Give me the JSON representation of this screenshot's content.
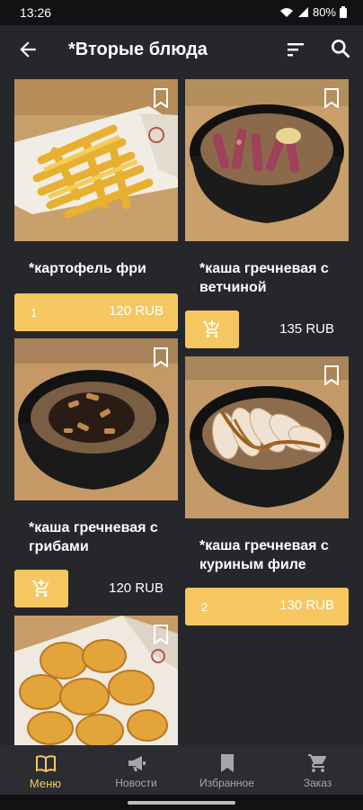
{
  "status": {
    "time": "13:26",
    "battery": "80%"
  },
  "header": {
    "title": "*Вторые блюда"
  },
  "products": [
    {
      "name": "*картофель фри",
      "price": "120 RUB",
      "qty": "1",
      "image": "fries"
    },
    {
      "name": "*каша гречневая с ветчиной",
      "price": "135 RUB",
      "image": "buckwheat-ham"
    },
    {
      "name": "*каша гречневая с грибами",
      "price": "120 RUB",
      "image": "buckwheat-mushrooms"
    },
    {
      "name": "*каша гречневая с куриным филе",
      "price": "130 RUB",
      "qty": "2",
      "image": "buckwheat-chicken"
    },
    {
      "name": "",
      "image": "nuggets"
    }
  ],
  "nav": [
    {
      "label": "Меню",
      "icon": "book-icon",
      "active": true
    },
    {
      "label": "Новости",
      "icon": "megaphone-icon"
    },
    {
      "label": "Избранное",
      "icon": "bookmark-icon"
    },
    {
      "label": "Заказ",
      "icon": "cart-icon"
    }
  ],
  "colors": {
    "accent": "#f6c760",
    "background": "#26272b",
    "navbar": "#2c2d31"
  }
}
